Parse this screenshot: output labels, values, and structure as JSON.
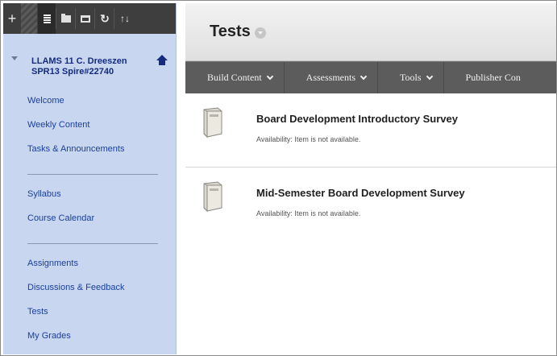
{
  "toolbar": {
    "add": "+",
    "refresh": "↻",
    "sort": "↑↓"
  },
  "course": {
    "title": "LLAMS 11 C. Dreeszen SPR13 Spire#22740"
  },
  "nav_groups": [
    [
      "Welcome",
      "Weekly Content",
      "Tasks & Announcements"
    ],
    [
      "Syllabus",
      "Course Calendar"
    ],
    [
      "Assignments",
      "Discussions & Feedback",
      "Tests",
      "My Grades"
    ]
  ],
  "page": {
    "title": "Tests"
  },
  "action_bar": [
    "Build Content",
    "Assessments",
    "Tools",
    "Publisher Con"
  ],
  "items": [
    {
      "title": "Board Development Introductory Survey",
      "availability_label": "Availability:",
      "availability_value": "Item is not available."
    },
    {
      "title": "Mid-Semester Board Development Survey",
      "availability_label": "Availability:",
      "availability_value": "Item is not available."
    }
  ],
  "colors": {
    "sidebar_bg": "#c9d6ef",
    "link": "#1a3f9e",
    "course_title": "#142b80",
    "action_bar": "#5c5c5c"
  }
}
